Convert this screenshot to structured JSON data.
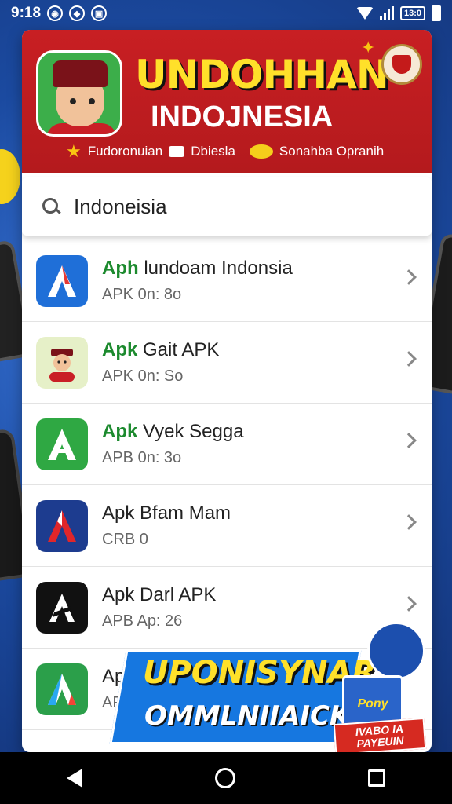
{
  "status_bar": {
    "time": "9:18",
    "battery_label": "13:0"
  },
  "header": {
    "title": "UNDOHHAN",
    "subtitle": "INDOJNESIA",
    "link_1": "Fudoronuian",
    "link_2": "Dbiesla",
    "link_3": "Sonahba Opranih",
    "colors": {
      "background": "#c81f23",
      "title": "#ffe02a"
    }
  },
  "search": {
    "value": "Indoneisia"
  },
  "apps": [
    {
      "prefix": "Aph",
      "name": "lundoam Indonsia",
      "meta": "APK 0n: 8o",
      "icon": "a-blue-icon"
    },
    {
      "prefix": "Apk",
      "name": "Gait APK",
      "meta": "APK 0n: So",
      "icon": "character-icon"
    },
    {
      "prefix": "Apk",
      "name": "Vyek Segga",
      "meta": "APB 0n: 3o",
      "icon": "a-green-icon"
    },
    {
      "prefix": "Apk",
      "name": "Bfam Mam",
      "meta": "CRB 0",
      "icon": "a-red-icon"
    },
    {
      "prefix": "Apk",
      "name": "Darl APK",
      "meta": "APB Ap: 26",
      "icon": "a-black-icon"
    },
    {
      "prefix": "Apk",
      "name": "",
      "meta": "AP",
      "icon": "a-colorful-icon"
    }
  ],
  "promo": {
    "line1": "UPONISYNAR",
    "line2": "OMMLNIIAICKN",
    "box_label": "Pony",
    "tag_label": "IVABO IA PAYEUIN"
  }
}
